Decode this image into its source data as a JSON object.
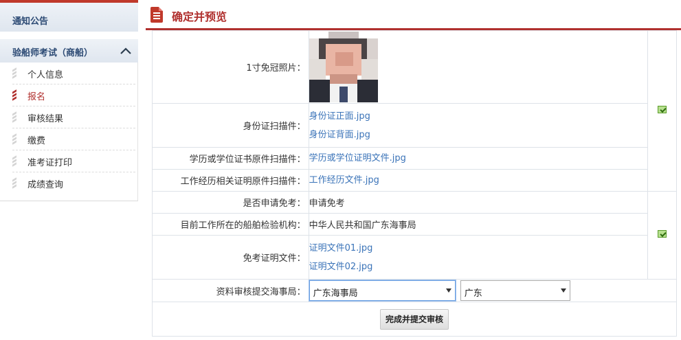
{
  "sidebar": {
    "notice_label": "通知公告",
    "group_label": "验船师考试（商船）",
    "items": [
      {
        "label": "个人信息",
        "active": false
      },
      {
        "label": "报名",
        "active": true
      },
      {
        "label": "审核结果",
        "active": false
      },
      {
        "label": "缴费",
        "active": false
      },
      {
        "label": "准考证打印",
        "active": false
      },
      {
        "label": "成绩查询",
        "active": false
      }
    ]
  },
  "header": {
    "title": "确定并预览"
  },
  "form": {
    "photo_label": "1寸免冠照片：",
    "id_scan_label": "身份证扫描件：",
    "id_front_file": "身份证正面.jpg",
    "id_back_file": "身份证背面.jpg",
    "degree_label": "学历或学位证书原件扫描件：",
    "degree_file": "学历或学位证明文件.jpg",
    "work_label": "工作经历相关证明原件扫描件：",
    "work_file": "工作经历文件.jpg",
    "exempt_apply_label": "是否申请免考：",
    "exempt_apply_value": "申请免考",
    "org_label": "目前工作所在的船舶检验机构：",
    "org_value": "中华人民共和国广东海事局",
    "exempt_proof_label": "免考证明文件：",
    "exempt_file_1": "证明文件01.jpg",
    "exempt_file_2": "证明文件02.jpg",
    "submit_bureau_label": "资料审核提交海事局：",
    "bureau_select": "广东海事局",
    "province_select": "广东",
    "submit_button": "完成并提交审核"
  },
  "colors": {
    "accent": "#b0302e",
    "link": "#3a73b8",
    "sidebar_text": "#2c4a74"
  }
}
